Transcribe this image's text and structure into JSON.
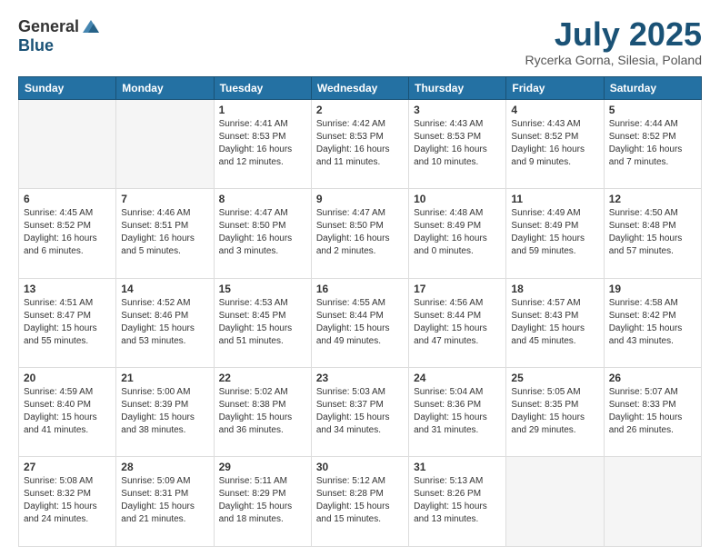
{
  "logo": {
    "general": "General",
    "blue": "Blue"
  },
  "title": "July 2025",
  "subtitle": "Rycerka Gorna, Silesia, Poland",
  "days_of_week": [
    "Sunday",
    "Monday",
    "Tuesday",
    "Wednesday",
    "Thursday",
    "Friday",
    "Saturday"
  ],
  "weeks": [
    [
      {
        "day": "",
        "info": ""
      },
      {
        "day": "",
        "info": ""
      },
      {
        "day": "1",
        "info": "Sunrise: 4:41 AM\nSunset: 8:53 PM\nDaylight: 16 hours and 12 minutes."
      },
      {
        "day": "2",
        "info": "Sunrise: 4:42 AM\nSunset: 8:53 PM\nDaylight: 16 hours and 11 minutes."
      },
      {
        "day": "3",
        "info": "Sunrise: 4:43 AM\nSunset: 8:53 PM\nDaylight: 16 hours and 10 minutes."
      },
      {
        "day": "4",
        "info": "Sunrise: 4:43 AM\nSunset: 8:52 PM\nDaylight: 16 hours and 9 minutes."
      },
      {
        "day": "5",
        "info": "Sunrise: 4:44 AM\nSunset: 8:52 PM\nDaylight: 16 hours and 7 minutes."
      }
    ],
    [
      {
        "day": "6",
        "info": "Sunrise: 4:45 AM\nSunset: 8:52 PM\nDaylight: 16 hours and 6 minutes."
      },
      {
        "day": "7",
        "info": "Sunrise: 4:46 AM\nSunset: 8:51 PM\nDaylight: 16 hours and 5 minutes."
      },
      {
        "day": "8",
        "info": "Sunrise: 4:47 AM\nSunset: 8:50 PM\nDaylight: 16 hours and 3 minutes."
      },
      {
        "day": "9",
        "info": "Sunrise: 4:47 AM\nSunset: 8:50 PM\nDaylight: 16 hours and 2 minutes."
      },
      {
        "day": "10",
        "info": "Sunrise: 4:48 AM\nSunset: 8:49 PM\nDaylight: 16 hours and 0 minutes."
      },
      {
        "day": "11",
        "info": "Sunrise: 4:49 AM\nSunset: 8:49 PM\nDaylight: 15 hours and 59 minutes."
      },
      {
        "day": "12",
        "info": "Sunrise: 4:50 AM\nSunset: 8:48 PM\nDaylight: 15 hours and 57 minutes."
      }
    ],
    [
      {
        "day": "13",
        "info": "Sunrise: 4:51 AM\nSunset: 8:47 PM\nDaylight: 15 hours and 55 minutes."
      },
      {
        "day": "14",
        "info": "Sunrise: 4:52 AM\nSunset: 8:46 PM\nDaylight: 15 hours and 53 minutes."
      },
      {
        "day": "15",
        "info": "Sunrise: 4:53 AM\nSunset: 8:45 PM\nDaylight: 15 hours and 51 minutes."
      },
      {
        "day": "16",
        "info": "Sunrise: 4:55 AM\nSunset: 8:44 PM\nDaylight: 15 hours and 49 minutes."
      },
      {
        "day": "17",
        "info": "Sunrise: 4:56 AM\nSunset: 8:44 PM\nDaylight: 15 hours and 47 minutes."
      },
      {
        "day": "18",
        "info": "Sunrise: 4:57 AM\nSunset: 8:43 PM\nDaylight: 15 hours and 45 minutes."
      },
      {
        "day": "19",
        "info": "Sunrise: 4:58 AM\nSunset: 8:42 PM\nDaylight: 15 hours and 43 minutes."
      }
    ],
    [
      {
        "day": "20",
        "info": "Sunrise: 4:59 AM\nSunset: 8:40 PM\nDaylight: 15 hours and 41 minutes."
      },
      {
        "day": "21",
        "info": "Sunrise: 5:00 AM\nSunset: 8:39 PM\nDaylight: 15 hours and 38 minutes."
      },
      {
        "day": "22",
        "info": "Sunrise: 5:02 AM\nSunset: 8:38 PM\nDaylight: 15 hours and 36 minutes."
      },
      {
        "day": "23",
        "info": "Sunrise: 5:03 AM\nSunset: 8:37 PM\nDaylight: 15 hours and 34 minutes."
      },
      {
        "day": "24",
        "info": "Sunrise: 5:04 AM\nSunset: 8:36 PM\nDaylight: 15 hours and 31 minutes."
      },
      {
        "day": "25",
        "info": "Sunrise: 5:05 AM\nSunset: 8:35 PM\nDaylight: 15 hours and 29 minutes."
      },
      {
        "day": "26",
        "info": "Sunrise: 5:07 AM\nSunset: 8:33 PM\nDaylight: 15 hours and 26 minutes."
      }
    ],
    [
      {
        "day": "27",
        "info": "Sunrise: 5:08 AM\nSunset: 8:32 PM\nDaylight: 15 hours and 24 minutes."
      },
      {
        "day": "28",
        "info": "Sunrise: 5:09 AM\nSunset: 8:31 PM\nDaylight: 15 hours and 21 minutes."
      },
      {
        "day": "29",
        "info": "Sunrise: 5:11 AM\nSunset: 8:29 PM\nDaylight: 15 hours and 18 minutes."
      },
      {
        "day": "30",
        "info": "Sunrise: 5:12 AM\nSunset: 8:28 PM\nDaylight: 15 hours and 15 minutes."
      },
      {
        "day": "31",
        "info": "Sunrise: 5:13 AM\nSunset: 8:26 PM\nDaylight: 15 hours and 13 minutes."
      },
      {
        "day": "",
        "info": ""
      },
      {
        "day": "",
        "info": ""
      }
    ]
  ]
}
